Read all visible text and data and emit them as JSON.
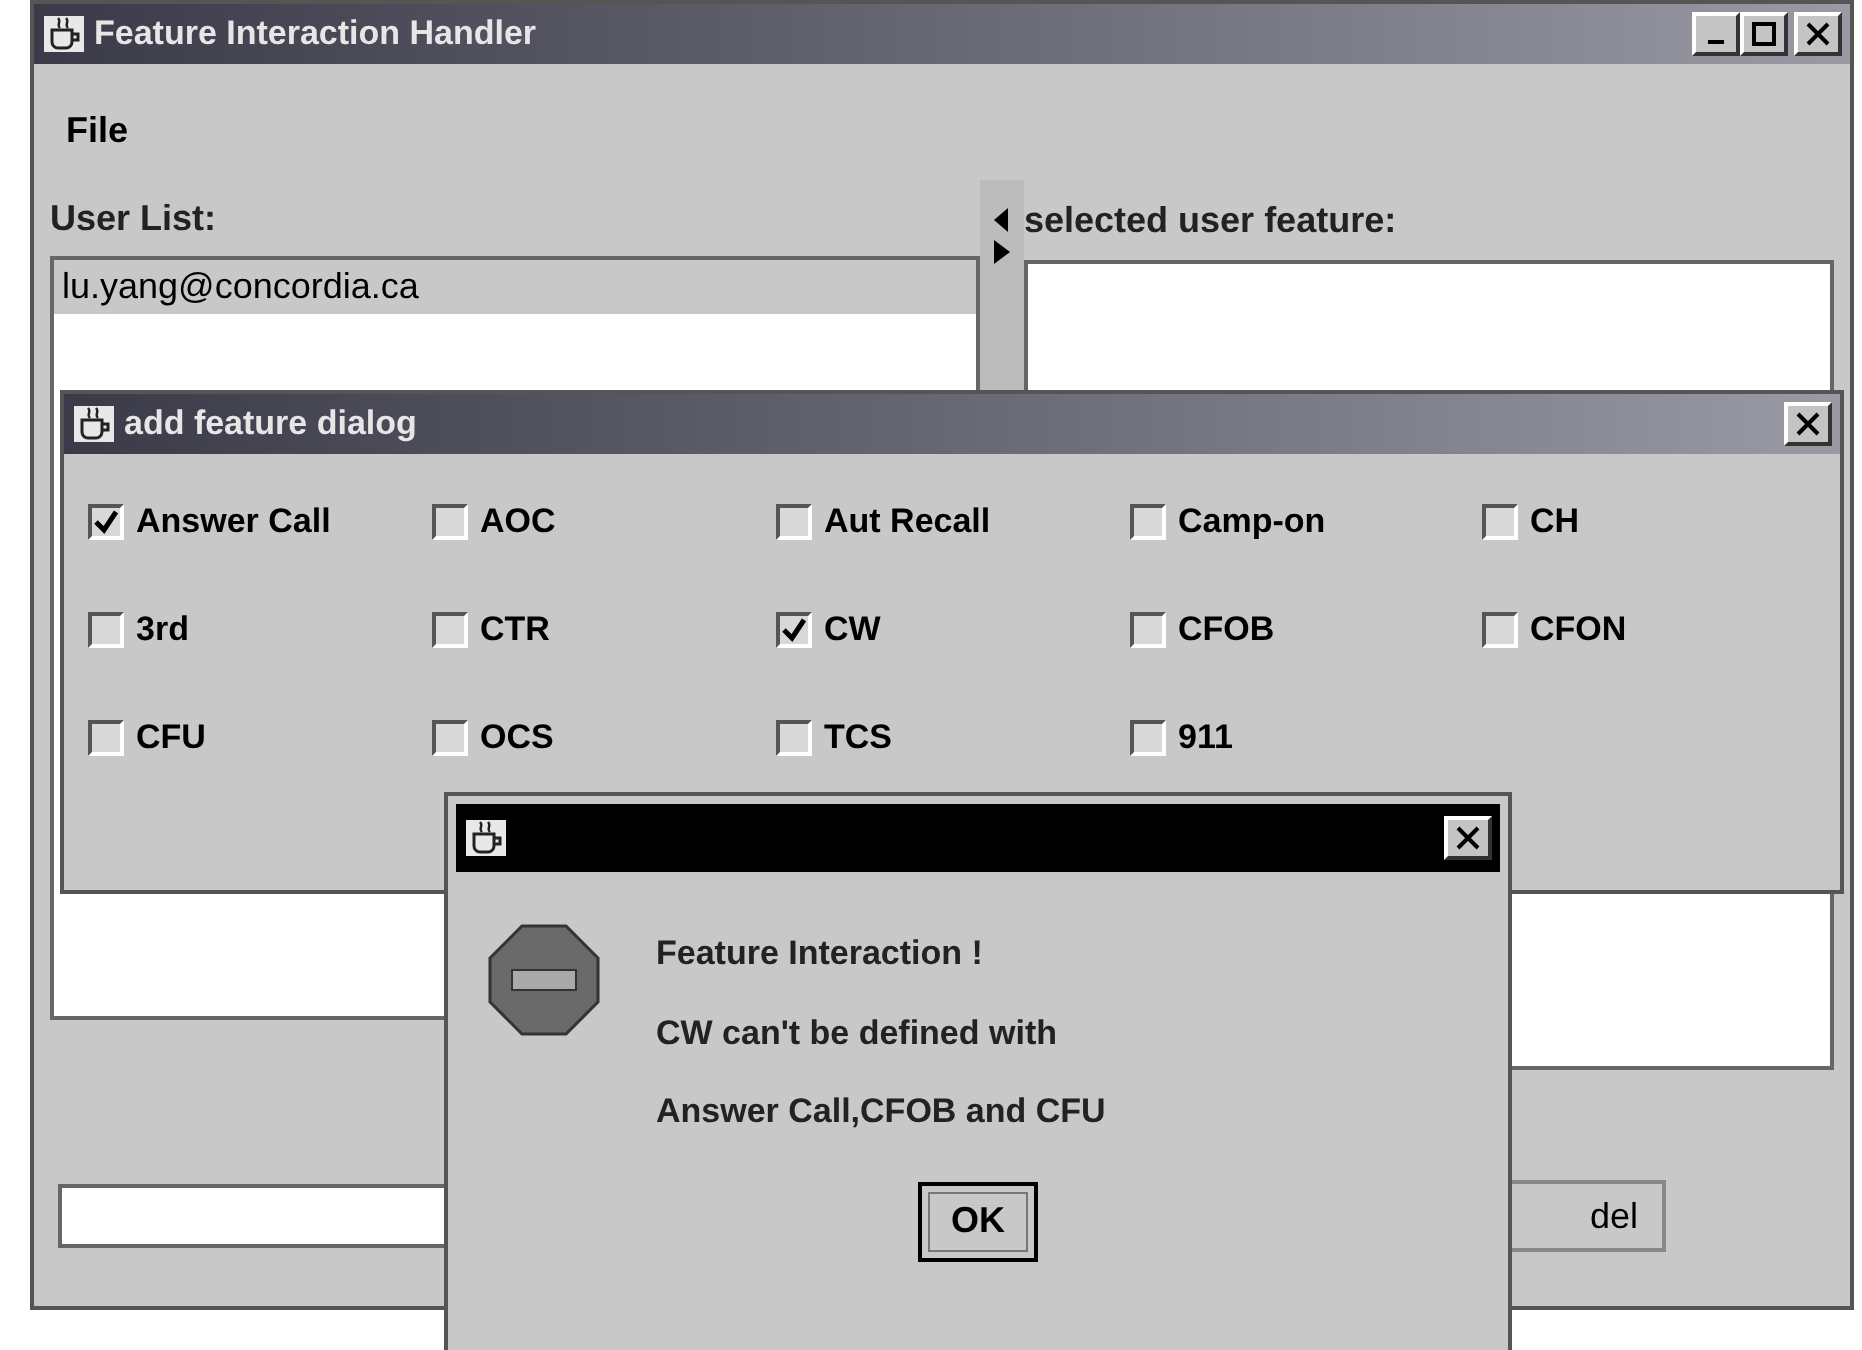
{
  "main_window": {
    "title": "Feature Interaction Handler",
    "menu": [
      "File"
    ],
    "user_list": {
      "label": "User List:",
      "items": [
        "lu.yang@concordia.ca"
      ]
    },
    "feature_panel": {
      "label": "selected user feature:"
    },
    "bottom_button": "del"
  },
  "feature_dialog": {
    "title": "add feature dialog",
    "features": [
      {
        "label": "Answer Call",
        "checked": true
      },
      {
        "label": "AOC",
        "checked": false
      },
      {
        "label": "Aut Recall",
        "checked": false
      },
      {
        "label": "Camp-on",
        "checked": false
      },
      {
        "label": "CH",
        "checked": false
      },
      {
        "label": "3rd",
        "checked": false
      },
      {
        "label": "CTR",
        "checked": false
      },
      {
        "label": "CW",
        "checked": true
      },
      {
        "label": "CFOB",
        "checked": false
      },
      {
        "label": "CFON",
        "checked": false
      },
      {
        "label": "CFU",
        "checked": false
      },
      {
        "label": "OCS",
        "checked": false
      },
      {
        "label": "TCS",
        "checked": false
      },
      {
        "label": "911",
        "checked": false
      }
    ]
  },
  "message_dialog": {
    "lines": [
      "Feature Interaction !",
      "CW can't be defined with",
      "Answer Call,CFOB and CFU"
    ],
    "button": "OK"
  }
}
